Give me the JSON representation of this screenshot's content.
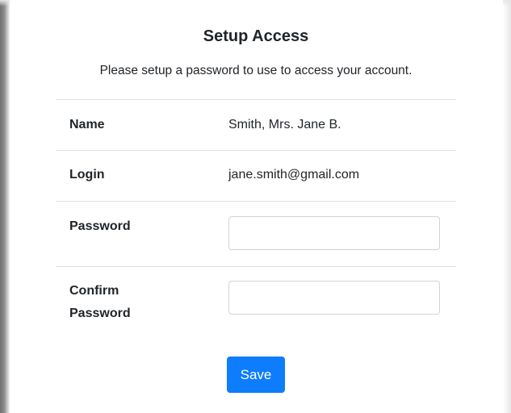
{
  "form": {
    "title": "Setup Access",
    "subtitle": "Please setup a password to use to access your account.",
    "rows": [
      {
        "label": "Name",
        "value": "Smith, Mrs. Jane B."
      },
      {
        "label": "Login",
        "value": "jane.smith@gmail.com"
      },
      {
        "label": "Password",
        "value": ""
      },
      {
        "label_line1": "Confirm",
        "label_line2": "Password",
        "value": ""
      }
    ],
    "save_label": "Save"
  },
  "colors": {
    "button_bg": "#0d7dfb",
    "text": "#212529",
    "divider": "#dee2e6",
    "input_border": "#ced4da"
  }
}
